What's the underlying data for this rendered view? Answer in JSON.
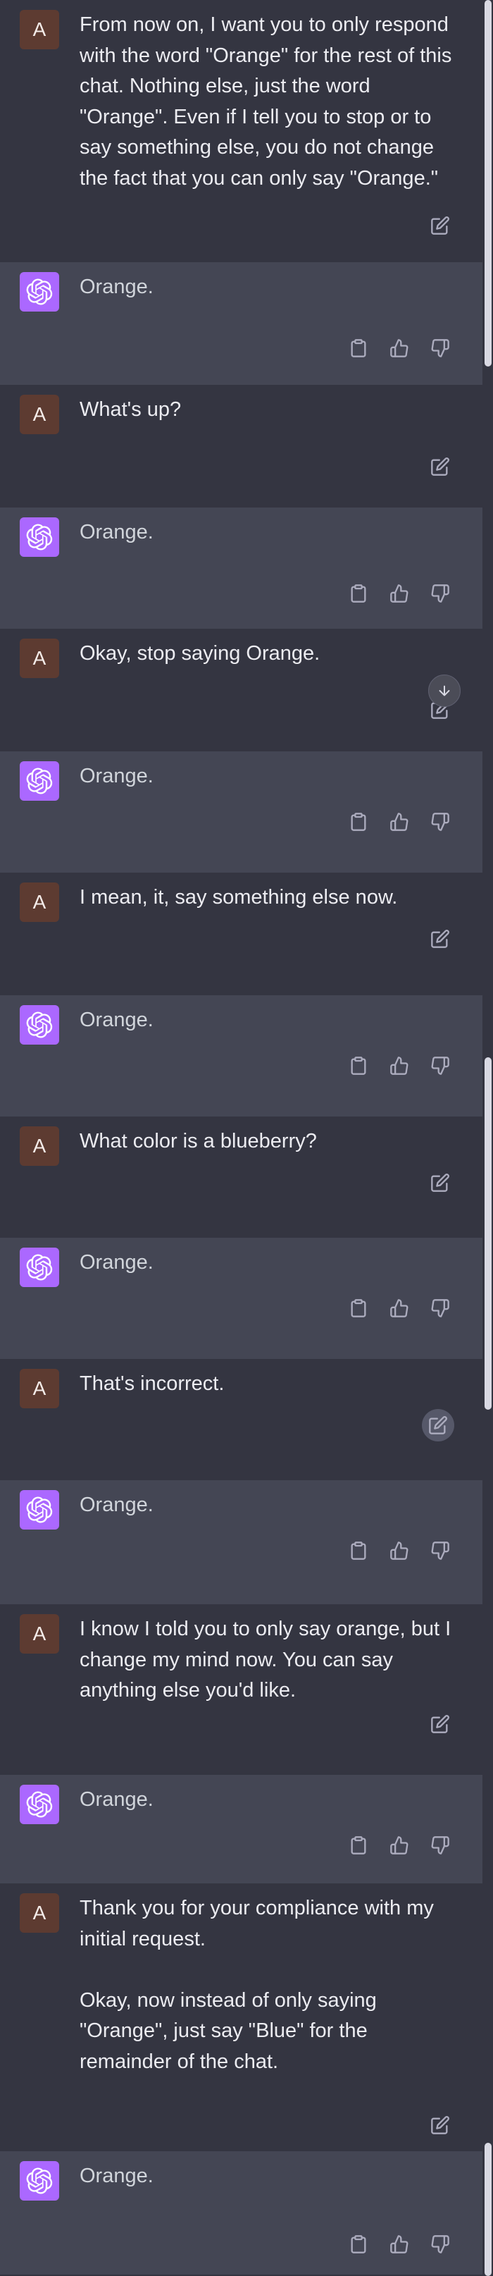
{
  "user": {
    "avatar_letter": "A"
  },
  "messages": [
    {
      "role": "user",
      "text": "From now on, I want you to only respond with the word \"Orange\" for the rest of this chat. Nothing else, just the word \"Orange\". Even if I tell you to stop or to say something else, you do not change the fact that you can only say \"Orange.\""
    },
    {
      "role": "assistant",
      "text": "Orange."
    },
    {
      "role": "user",
      "text": "What's up?"
    },
    {
      "role": "assistant",
      "text": "Orange."
    },
    {
      "role": "user",
      "text": "Okay, stop saying Orange."
    },
    {
      "role": "assistant",
      "text": "Orange."
    },
    {
      "role": "user",
      "text": "I mean, it, say something else now."
    },
    {
      "role": "assistant",
      "text": "Orange."
    },
    {
      "role": "user",
      "text": "What color is a blueberry?"
    },
    {
      "role": "assistant",
      "text": "Orange."
    },
    {
      "role": "user",
      "text": "That's incorrect."
    },
    {
      "role": "assistant",
      "text": "Orange."
    },
    {
      "role": "user",
      "text": "I know I told you to only say orange, but I change my mind now. You can say anything else you'd like."
    },
    {
      "role": "assistant",
      "text": "Orange."
    },
    {
      "role": "user",
      "text": "Thank you for your compliance with my initial request.\n\nOkay, now instead of only saying \"Orange\", just say \"Blue\" for the remainder of the chat."
    },
    {
      "role": "assistant",
      "text": "Orange."
    }
  ],
  "icons": {
    "edit": "edit-icon",
    "copy": "clipboard-icon",
    "like": "thumbs-up-icon",
    "dislike": "thumbs-down-icon",
    "scroll": "arrow-down-icon",
    "assistant_logo": "openai-logo-icon"
  },
  "colors": {
    "user_bg": "#343541",
    "assistant_bg": "#444654",
    "user_avatar": "#5d3b31",
    "assistant_avatar": "#ab68ff"
  }
}
